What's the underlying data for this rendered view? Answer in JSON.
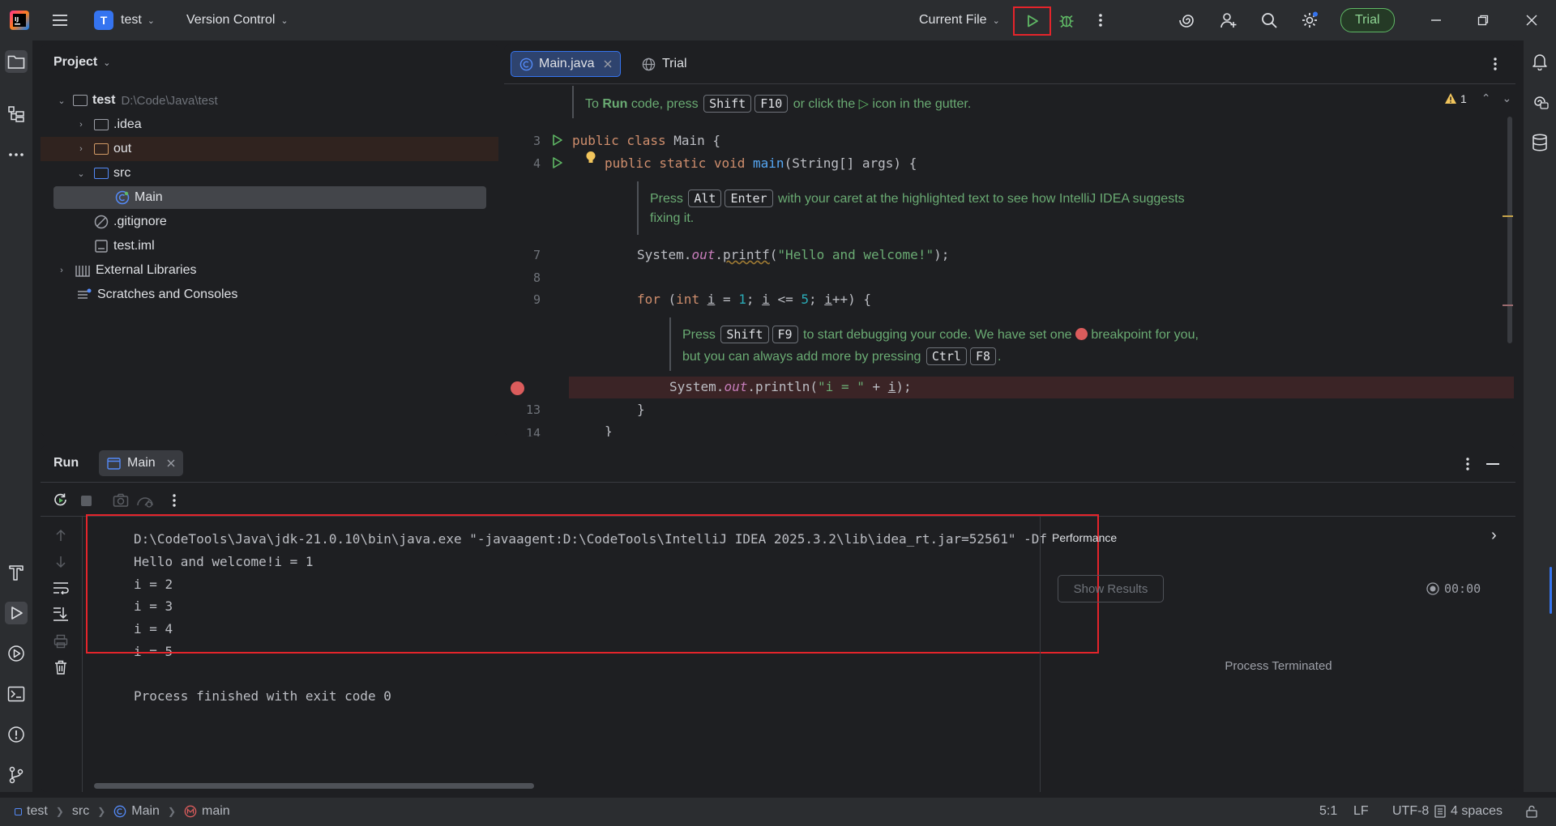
{
  "titlebar": {
    "project_letter": "T",
    "project_name": "test",
    "vcs_label": "Version Control",
    "run_config": "Current File",
    "trial_label": "Trial"
  },
  "project_panel": {
    "title": "Project",
    "tree": [
      {
        "label": "test",
        "path": "D:\\Code\\Java\\test"
      },
      {
        "label": ".idea"
      },
      {
        "label": "out"
      },
      {
        "label": "src"
      },
      {
        "label": "Main"
      },
      {
        "label": ".gitignore"
      },
      {
        "label": "test.iml"
      },
      {
        "label": "External Libraries"
      },
      {
        "label": "Scratches and Consoles"
      }
    ]
  },
  "editor": {
    "tabs": [
      {
        "label": "Main.java",
        "icon": "class-icon"
      },
      {
        "label": "Trial",
        "icon": "globe-icon"
      }
    ],
    "warning_count": "1",
    "line_numbers": [
      "3",
      "4",
      "7",
      "8",
      "9",
      "13",
      "14"
    ],
    "doc1": {
      "pre": "To ",
      "bold": "Run",
      "mid": " code, press ",
      "key1": "Shift",
      "key2": "F10",
      "post": " or click the ",
      "post2": " icon in the gutter."
    },
    "doc2": {
      "pre": "Press ",
      "key1": "Alt",
      "key2": "Enter",
      "line1": " with your caret at the highlighted text to see how IntelliJ IDEA suggests",
      "line2": "fixing it."
    },
    "doc3": {
      "pre": "Press ",
      "key1": "Shift",
      "key2": "F9",
      "mid": " to start debugging your code. We have set one ",
      "post": " breakpoint for you,",
      "line2": "but you can always add more by pressing ",
      "key3": "Ctrl",
      "key4": "F8",
      "end": "."
    }
  },
  "run_panel": {
    "title": "Run",
    "tab_label": "Main",
    "output": [
      "D:\\CodeTools\\Java\\jdk-21.0.10\\bin\\java.exe \"-javaagent:D:\\CodeTools\\IntelliJ IDEA 2025.3.2\\lib\\idea_rt.jar=52561\" -Df",
      "Hello and welcome!i = 1",
      "i = 2",
      "i = 3",
      "i = 4",
      "i = 5",
      "",
      "Process finished with exit code 0"
    ],
    "performance": {
      "title": "Performance",
      "show_results": "Show Results",
      "timer": "00:00",
      "status": "Process Terminated"
    }
  },
  "statusbar": {
    "crumbs": [
      "test",
      "src",
      "Main",
      "main"
    ],
    "position": "5:1",
    "line_ending": "LF",
    "encoding": "UTF-8",
    "indent": "4 spaces"
  },
  "colors": {
    "accent": "#3574f0",
    "highlight_outline": "#e4242b",
    "run_green": "#5fb865",
    "breakpoint": "#db5c5c"
  }
}
